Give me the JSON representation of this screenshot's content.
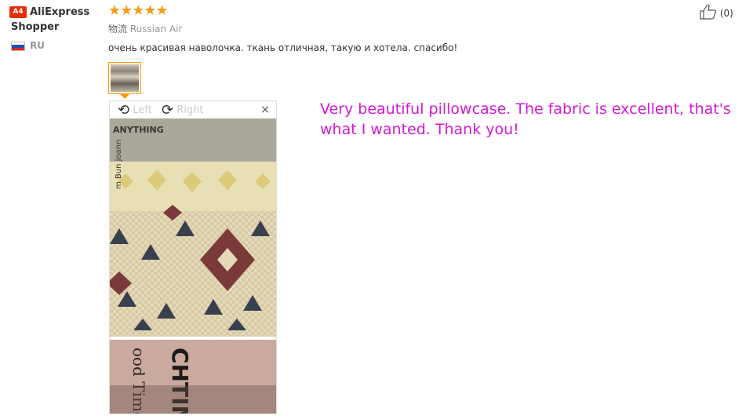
{
  "user": {
    "badge": "A4",
    "name": "AliExpress Shopper",
    "country_code": "RU"
  },
  "review": {
    "stars": "★★★★★",
    "rating": 5,
    "logistics_label": "物流",
    "logistics_value": "Russian Air",
    "text": "очень красивая наволочка. ткань отличная, такую и хотела. спасибо!"
  },
  "viewer": {
    "rotate_left_label": "Left",
    "rotate_right_label": "Right",
    "close_label": "×",
    "photo_text_top": "ANYTHING",
    "photo_text_side": "m Bun joann",
    "photo_text_bottom": "ood Time",
    "photo_text_bottom2": "CHTIM"
  },
  "like": {
    "count": "(0)"
  },
  "translation": "Very beautiful pillowcase. The fabric is excellent, that's what I wanted. Thank you!",
  "colors": {
    "star": "#f49c1c",
    "accent": "#ff9900",
    "translation": "#d21ad2",
    "badge": "#e62e04"
  }
}
